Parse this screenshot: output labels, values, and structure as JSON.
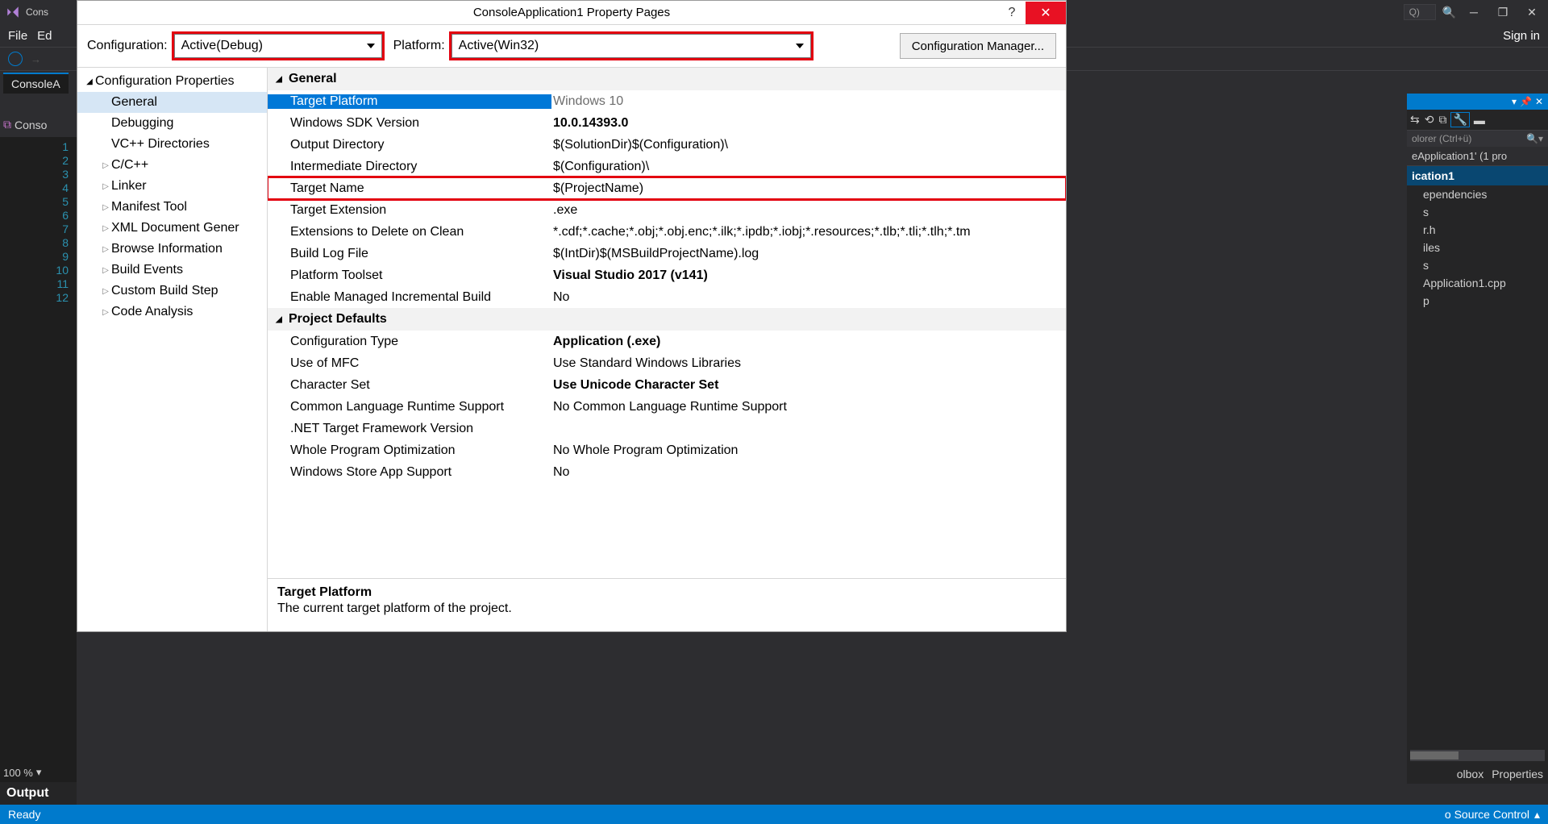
{
  "vs": {
    "title_fragment": "Cons",
    "menubar": {
      "file": "File",
      "edit_fragment": "Ed"
    },
    "signin": "Sign in",
    "quicklaunch_fragment": "Q)",
    "doc_tab": "ConsoleA",
    "open_tab": "Conso",
    "editor_lines": [
      "1",
      "2",
      "3",
      "4",
      "5",
      "6",
      "7",
      "8",
      "9",
      "10",
      "11",
      "12"
    ],
    "zoom": "100 %",
    "output_header": "Output",
    "status_ready": "Ready",
    "status_right": "o Source Control",
    "solution_explorer": {
      "search_fragment": "olorer (Ctrl+ü)",
      "solution_line": "eApplication1' (1 pro",
      "project_fragment": "ication1",
      "nodes": [
        "ependencies",
        "s",
        "r.h",
        "iles",
        "s",
        "Application1.cpp",
        "p"
      ],
      "tabs": {
        "toolbox": "olbox",
        "properties": "Properties"
      }
    }
  },
  "dialog": {
    "title": "ConsoleApplication1 Property Pages",
    "config_label": "Configuration:",
    "config_value": "Active(Debug)",
    "platform_label": "Platform:",
    "platform_value": "Active(Win32)",
    "cfg_manager": "Configuration Manager...",
    "tree": {
      "root": "Configuration Properties",
      "items": [
        "General",
        "Debugging",
        "VC++ Directories",
        "C/C++",
        "Linker",
        "Manifest Tool",
        "XML Document Gener",
        "Browse Information",
        "Build Events",
        "Custom Build Step",
        "Code Analysis"
      ]
    },
    "sections": [
      {
        "title": "General",
        "rows": [
          {
            "k": "Target Platform",
            "v": "Windows 10",
            "selected": true
          },
          {
            "k": "Windows SDK Version",
            "v": "10.0.14393.0",
            "bold": true
          },
          {
            "k": "Output Directory",
            "v": "$(SolutionDir)$(Configuration)\\"
          },
          {
            "k": "Intermediate Directory",
            "v": "$(Configuration)\\"
          },
          {
            "k": "Target Name",
            "v": "$(ProjectName)",
            "ring": true
          },
          {
            "k": "Target Extension",
            "v": ".exe"
          },
          {
            "k": "Extensions to Delete on Clean",
            "v": "*.cdf;*.cache;*.obj;*.obj.enc;*.ilk;*.ipdb;*.iobj;*.resources;*.tlb;*.tli;*.tlh;*.tm"
          },
          {
            "k": "Build Log File",
            "v": "$(IntDir)$(MSBuildProjectName).log"
          },
          {
            "k": "Platform Toolset",
            "v": "Visual Studio 2017 (v141)",
            "bold": true
          },
          {
            "k": "Enable Managed Incremental Build",
            "v": "No"
          }
        ]
      },
      {
        "title": "Project Defaults",
        "rows": [
          {
            "k": "Configuration Type",
            "v": "Application (.exe)",
            "bold": true
          },
          {
            "k": "Use of MFC",
            "v": "Use Standard Windows Libraries"
          },
          {
            "k": "Character Set",
            "v": "Use Unicode Character Set",
            "bold": true
          },
          {
            "k": "Common Language Runtime Support",
            "v": "No Common Language Runtime Support"
          },
          {
            "k": ".NET Target Framework Version",
            "v": ""
          },
          {
            "k": "Whole Program Optimization",
            "v": "No Whole Program Optimization"
          },
          {
            "k": "Windows Store App Support",
            "v": "No"
          }
        ]
      }
    ],
    "desc": {
      "title": "Target Platform",
      "body": "The current target platform of the project."
    }
  }
}
